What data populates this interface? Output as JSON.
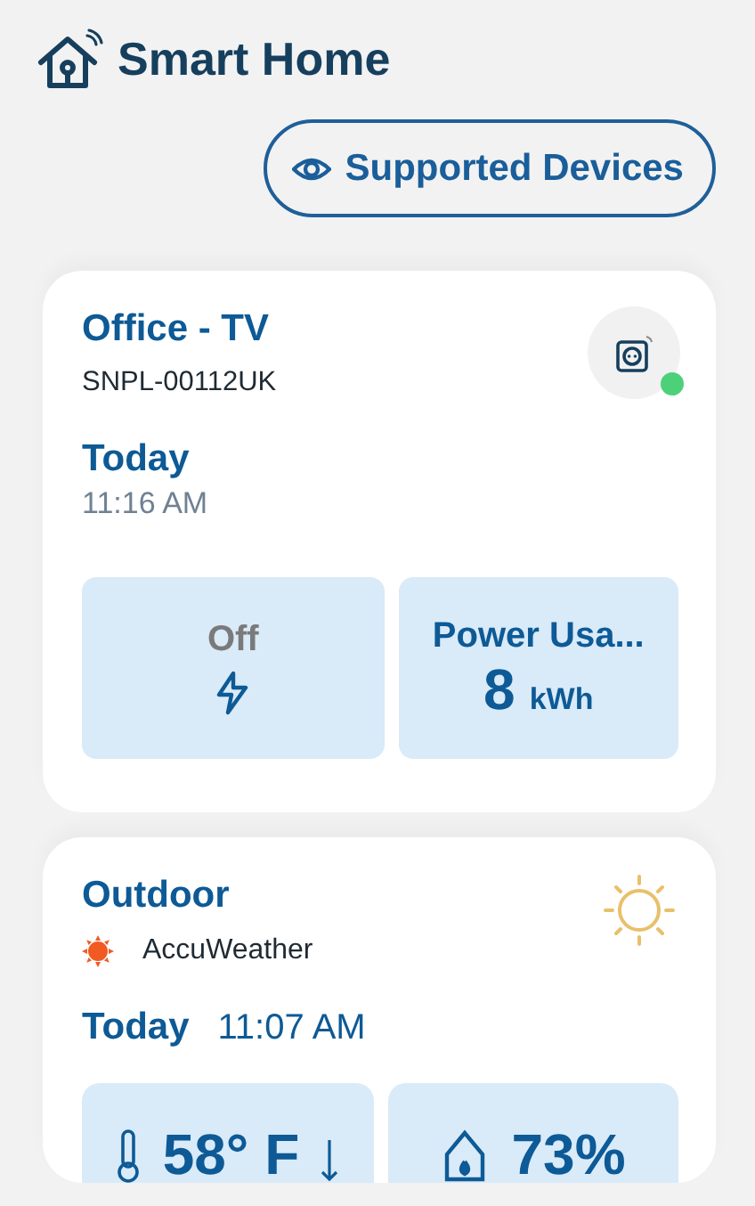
{
  "app": {
    "title": "Smart Home"
  },
  "supported_button": {
    "label": "Supported Devices"
  },
  "devices": [
    {
      "kind": "plug",
      "name": "Office - TV",
      "serial": "SNPL-00112UK",
      "online": true,
      "day": "Today",
      "time": "11:16 AM",
      "tiles": [
        {
          "kind": "status",
          "label": "Off",
          "on": false
        },
        {
          "kind": "usage",
          "label": "Power Usa...",
          "value": "8",
          "unit": "kWh"
        }
      ]
    },
    {
      "kind": "weather",
      "name": "Outdoor",
      "source": "AccuWeather",
      "day": "Today",
      "time": "11:07 AM",
      "tiles": [
        {
          "kind": "temperature",
          "value": "58° F"
        },
        {
          "kind": "humidity",
          "value": "73%"
        }
      ]
    }
  ]
}
